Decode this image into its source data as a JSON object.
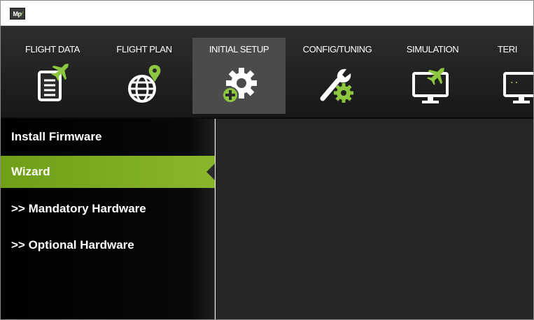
{
  "titlebar": {
    "logo_text": "Mp"
  },
  "menu": {
    "items": [
      {
        "label": "FLIGHT DATA",
        "icon": "flight-data-icon"
      },
      {
        "label": "FLIGHT PLAN",
        "icon": "flight-plan-icon"
      },
      {
        "label": "INITIAL SETUP",
        "icon": "initial-setup-icon",
        "active": true
      },
      {
        "label": "CONFIG/TUNING",
        "icon": "config-tuning-icon"
      },
      {
        "label": "SIMULATION",
        "icon": "simulation-icon"
      },
      {
        "label": "TERI",
        "icon": "terminal-icon"
      }
    ]
  },
  "sidebar": {
    "items": [
      {
        "label": "Install Firmware"
      },
      {
        "label": "Wizard",
        "selected": true
      },
      {
        "label": ">> Mandatory Hardware"
      },
      {
        "label": ">> Optional Hardware"
      }
    ]
  },
  "colors": {
    "accent_green": "#8dc63f",
    "selected_green": "#7aaa1f",
    "toolbar_bg": "#1f1f1f",
    "panel_bg": "#262626"
  }
}
